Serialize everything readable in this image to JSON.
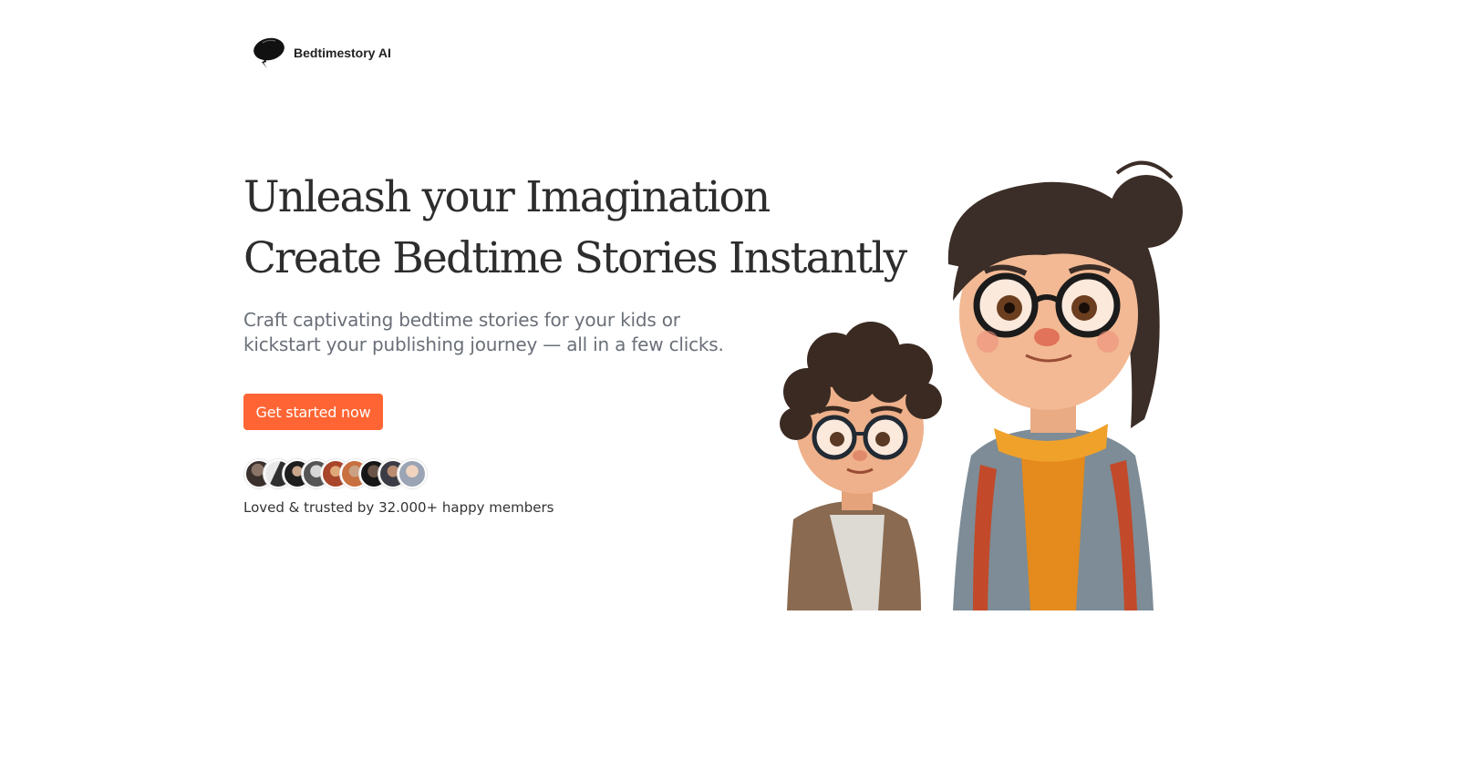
{
  "brand": {
    "name": "Bedtimestory AI",
    "logo_icon": "speech-bubble-icon"
  },
  "hero": {
    "title_line1": "Unleash your Imagination",
    "title_line2": "Create Bedtime Stories Instantly",
    "subtitle": "Craft captivating bedtime stories for your kids or kickstart your publishing journey — all in a few clicks.",
    "cta_label": "Get started now",
    "trust_text": "Loved & trusted by 32.000+ happy members"
  },
  "colors": {
    "accent": "#ff6534",
    "title": "#2d2d2d",
    "subtitle": "#6a6f78"
  },
  "illustration": {
    "subject": "cartoon-children-illustration"
  }
}
